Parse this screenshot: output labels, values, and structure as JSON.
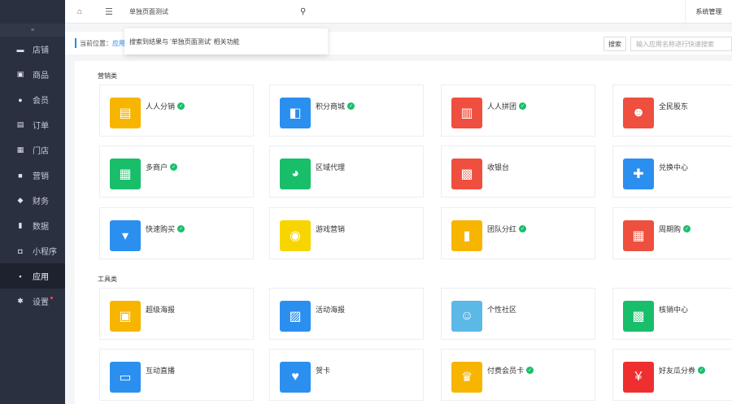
{
  "topbar": {
    "search_text": "单独页面测试",
    "right_label": "系统管理"
  },
  "dropdown": {
    "text": "搜索到结果与 '单独页面测试' 相关功能"
  },
  "breadcrumb": {
    "prefix": "当前位置：",
    "link": "应用"
  },
  "search": {
    "select_label": "搜索",
    "placeholder": "输入应用名称进行快速搜索"
  },
  "sidebar": {
    "items": [
      {
        "label": "店铺",
        "icon": "monitor-icon"
      },
      {
        "label": "商品",
        "icon": "image-icon"
      },
      {
        "label": "会员",
        "icon": "user-icon"
      },
      {
        "label": "订单",
        "icon": "document-icon"
      },
      {
        "label": "门店",
        "icon": "store-icon"
      },
      {
        "label": "营销",
        "icon": "gift-icon"
      },
      {
        "label": "财务",
        "icon": "wallet-icon"
      },
      {
        "label": "数据",
        "icon": "bar-chart-icon"
      },
      {
        "label": "小程序",
        "icon": "mini-program-icon"
      },
      {
        "label": "应用",
        "icon": "apps-grid-icon"
      },
      {
        "label": "设置",
        "icon": "gear-icon"
      }
    ]
  },
  "sections": [
    {
      "title": "营销类",
      "apps": [
        {
          "name": "人人分销",
          "verified": true,
          "color": "#f7b500",
          "icon": "distribution-icon"
        },
        {
          "name": "积分商城",
          "verified": true,
          "color": "#2b8ff0",
          "icon": "points-mall-icon"
        },
        {
          "name": "人人拼团",
          "verified": true,
          "color": "#ef4f3e",
          "icon": "group-buy-icon"
        },
        {
          "name": "全民股东",
          "verified": false,
          "color": "#ef4f3e",
          "icon": "shareholder-icon"
        },
        {
          "name": "多商户",
          "verified": true,
          "color": "#19be6b",
          "icon": "multi-merchant-icon"
        },
        {
          "name": "区域代理",
          "verified": false,
          "color": "#19be6b",
          "icon": "region-agent-icon"
        },
        {
          "name": "收银台",
          "verified": false,
          "color": "#ef4f3e",
          "icon": "cashier-icon"
        },
        {
          "name": "兑换中心",
          "verified": false,
          "color": "#2b8ff0",
          "icon": "exchange-gift-icon"
        },
        {
          "name": "快速购买",
          "verified": true,
          "color": "#2b8ff0",
          "icon": "quick-buy-icon"
        },
        {
          "name": "游戏营销",
          "verified": false,
          "color": "#f7d500",
          "icon": "game-wheel-icon"
        },
        {
          "name": "团队分红",
          "verified": true,
          "color": "#f7b500",
          "icon": "team-bonus-icon"
        },
        {
          "name": "周期购",
          "verified": true,
          "color": "#ef4f3e",
          "icon": "calendar-icon"
        }
      ]
    },
    {
      "title": "工具类",
      "apps": [
        {
          "name": "超级海报",
          "verified": false,
          "color": "#f7b500",
          "icon": "poster-icon"
        },
        {
          "name": "活动海报",
          "verified": false,
          "color": "#2b8ff0",
          "icon": "activity-poster-icon"
        },
        {
          "name": "个性社区",
          "verified": false,
          "color": "#5cb8e6",
          "icon": "community-icon"
        },
        {
          "name": "核销中心",
          "verified": false,
          "color": "#19be6b",
          "icon": "qr-code-icon"
        },
        {
          "name": "互动直播",
          "verified": false,
          "color": "#2b8ff0",
          "icon": "tv-live-icon"
        },
        {
          "name": "贺卡",
          "verified": false,
          "color": "#2b8ff0",
          "icon": "greeting-card-icon"
        },
        {
          "name": "付费会员卡",
          "verified": true,
          "color": "#f7b500",
          "icon": "vip-card-icon"
        },
        {
          "name": "好友瓜分券",
          "verified": true,
          "color": "#ef2f2f",
          "icon": "red-envelope-icon"
        }
      ]
    }
  ]
}
